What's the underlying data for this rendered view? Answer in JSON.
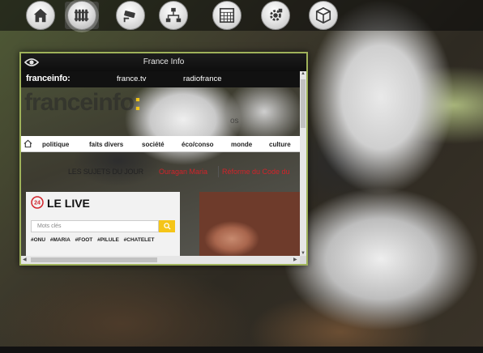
{
  "taskbar": {
    "icons": [
      "home-icon",
      "radiator-icon",
      "camera-icon",
      "network-icon",
      "calendar-icon",
      "settings-icon",
      "box-icon"
    ],
    "active_index": 1
  },
  "window": {
    "title": "France Info",
    "content": {
      "topbar": {
        "logo": "franceinfo:",
        "link_1": "france.tv",
        "link_2": "radiofrance"
      },
      "big_logo": "franceinfo",
      "big_logo_colon": ":",
      "partial_text": "os",
      "nav": [
        "politique",
        "faits divers",
        "société",
        "éco/conso",
        "monde",
        "culture"
      ],
      "sujets": {
        "heading": "LES SUJETS DU JOUR",
        "topic_1": "Ouragan Maria",
        "topic_2": "Réforme du Code du"
      },
      "live": {
        "title": "LE LIVE",
        "search_placeholder": "Mots clés",
        "tags": [
          "#ONU",
          "#MARIA",
          "#FOOT",
          "#PILULE",
          "#CHATELET"
        ]
      }
    }
  },
  "colors": {
    "window_border": "#9fb25a",
    "franceinfo_yellow": "#f0c419",
    "topic_red": "#d2232a"
  }
}
